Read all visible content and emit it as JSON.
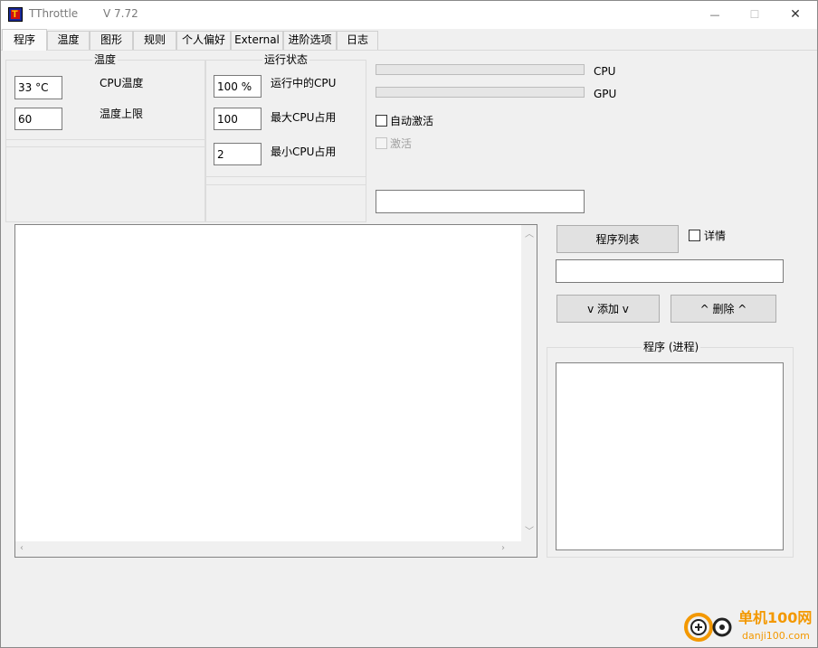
{
  "window": {
    "title": "TThrottle",
    "version": "V 7.72",
    "minimize_glyph": "—",
    "maximize_glyph": "☐",
    "close_glyph": "✕"
  },
  "tabs": [
    {
      "label": "程序"
    },
    {
      "label": "温度"
    },
    {
      "label": "图形"
    },
    {
      "label": "规则"
    },
    {
      "label": "个人偏好"
    },
    {
      "label": "External"
    },
    {
      "label": "进阶选项"
    },
    {
      "label": "日志"
    }
  ],
  "temperature_group": {
    "caption": "温度",
    "cpu_temp_value": "33 °C",
    "cpu_temp_label": "CPU温度",
    "temp_limit_value": "60",
    "temp_limit_label": "温度上限"
  },
  "status_group": {
    "caption": "运行状态",
    "running_cpu_value": "100 %",
    "running_cpu_label": "运行中的CPU",
    "max_cpu_value": "100",
    "max_cpu_label": "最大CPU占用",
    "min_cpu_value": "2",
    "min_cpu_label": "最小CPU占用"
  },
  "meters": {
    "cpu_label": "CPU",
    "gpu_label": "GPU",
    "cpu_level": 0,
    "gpu_level": 0
  },
  "options": {
    "auto_activate_label": "自动激活",
    "activate_label": "激活",
    "status_field_value": ""
  },
  "programs": {
    "program_list_button": "程序列表",
    "details_label": "详情",
    "program_input_value": "",
    "add_button": "v 添加 v",
    "delete_button": "^ 删除 ^",
    "process_group_caption": "程序 (进程)"
  },
  "watermark": {
    "brand": "单机100网",
    "url": "danji100.com",
    "accent": "#f39800"
  }
}
